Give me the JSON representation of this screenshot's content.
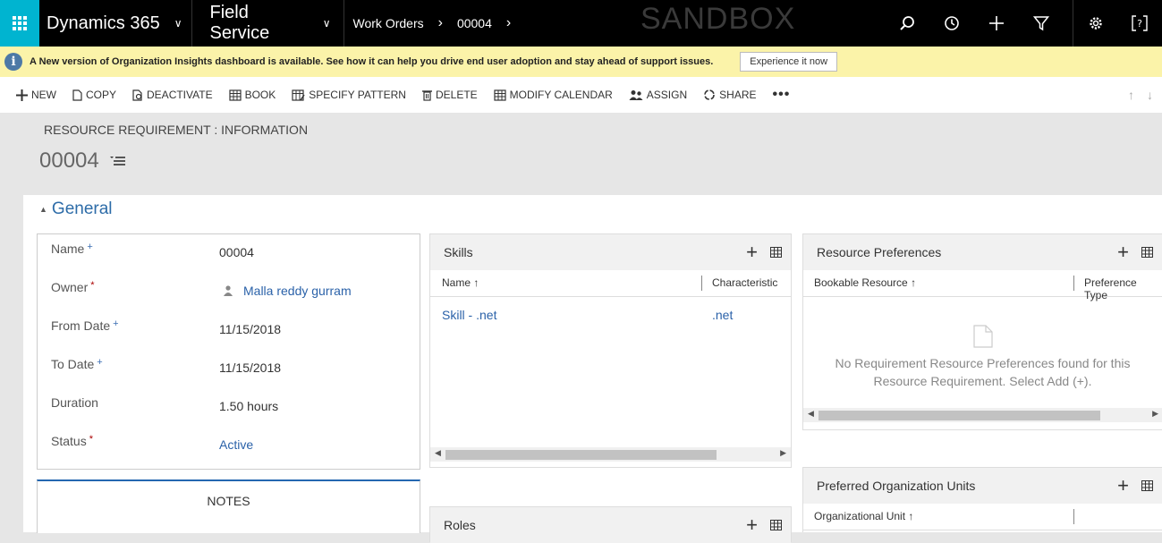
{
  "topbar": {
    "app_name": "Dynamics 365",
    "area_name": "Field Service",
    "breadcrumb": [
      "Work Orders",
      "00004"
    ],
    "environment": "SANDBOX"
  },
  "notice": {
    "message": "A New version of Organization Insights dashboard is available. See how it can help you drive end user adoption and stay ahead of support issues.",
    "button": "Experience it now"
  },
  "commands": {
    "new": "NEW",
    "copy": "COPY",
    "deactivate": "DEACTIVATE",
    "book": "BOOK",
    "specify_pattern": "SPECIFY PATTERN",
    "delete": "DELETE",
    "modify_calendar": "MODIFY CALENDAR",
    "assign": "ASSIGN",
    "share": "SHARE"
  },
  "header": {
    "entity": "RESOURCE REQUIREMENT : INFORMATION",
    "record": "00004"
  },
  "section": {
    "title": "General"
  },
  "fields": {
    "name": {
      "label": "Name",
      "value": "00004"
    },
    "owner": {
      "label": "Owner",
      "value": "Malla reddy gurram"
    },
    "from_date": {
      "label": "From Date",
      "value": "11/15/2018"
    },
    "to_date": {
      "label": "To Date",
      "value": "11/15/2018"
    },
    "duration": {
      "label": "Duration",
      "value": "1.50 hours"
    },
    "status": {
      "label": "Status",
      "value": "Active"
    }
  },
  "notes": {
    "title": "NOTES"
  },
  "skills": {
    "title": "Skills",
    "columns": [
      "Name ↑",
      "Characteristic"
    ],
    "rows": [
      {
        "name": "Skill - .net",
        "characteristic": ".net"
      }
    ]
  },
  "roles": {
    "title": "Roles"
  },
  "resource_preferences": {
    "title": "Resource Preferences",
    "columns": [
      "Bookable Resource ↑",
      "Preference Type"
    ],
    "empty_line1": "No Requirement Resource Preferences found for this",
    "empty_line2": "Resource Requirement. Select Add (+)."
  },
  "preferred_org_units": {
    "title": "Preferred Organization Units",
    "columns": [
      "Organizational Unit ↑"
    ]
  }
}
